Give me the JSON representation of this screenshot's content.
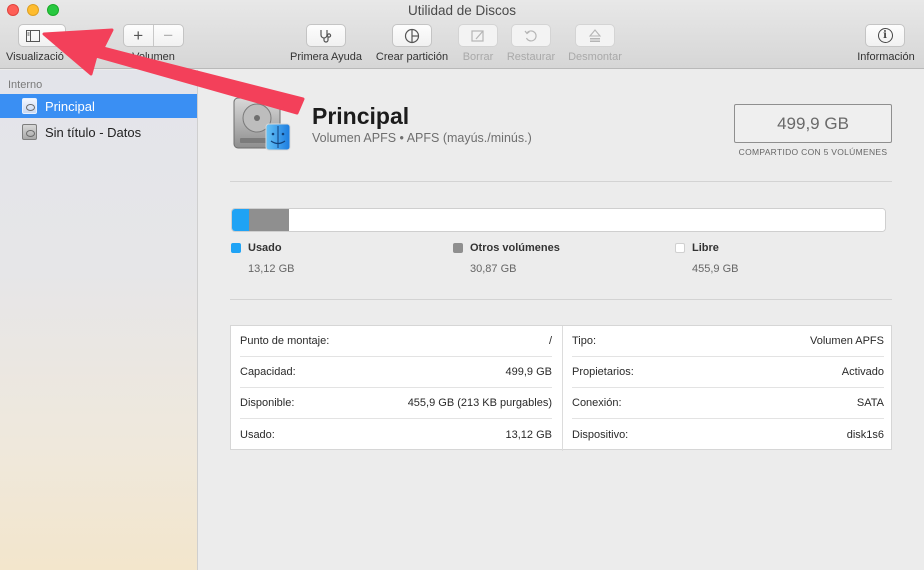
{
  "window": {
    "title": "Utilidad de Discos"
  },
  "toolbar": {
    "view_label": "Visualizació",
    "volume_label": "Volumen",
    "first_aid_label": "Primera Ayuda",
    "partition_label": "Crear partición",
    "erase_label": "Borrar",
    "restore_label": "Restaurar",
    "unmount_label": "Desmontar",
    "info_label": "Información",
    "volume_add_glyph": "+",
    "volume_remove_glyph": "−",
    "view_chevron_glyph": "⌄",
    "info_glyph": "i",
    "icons": [
      "sidebar-icon",
      "chevron-down-icon",
      "plus-icon",
      "minus-icon",
      "stethoscope-icon",
      "pie-chart-icon",
      "eraser-icon",
      "restore-icon",
      "eject-icon",
      "info-icon"
    ]
  },
  "sidebar": {
    "section": "Interno",
    "items": [
      {
        "label": "Principal",
        "selected": true
      },
      {
        "label": "Sin título - Datos",
        "selected": false
      }
    ]
  },
  "volume": {
    "name": "Principal",
    "subtitle": "Volumen APFS • APFS (mayús./minús.)",
    "capacity": "499,9 GB",
    "shared_note": "COMPARTIDO CON 5 VOLÚMENES"
  },
  "usage": {
    "total_gb": 499.9,
    "segments": [
      {
        "name": "Usado",
        "value": "13,12 GB",
        "gb": 13.12,
        "color": "#1fa3f5"
      },
      {
        "name": "Otros volúmenes",
        "value": "30,87 GB",
        "gb": 30.87,
        "color": "#8f8f8f"
      },
      {
        "name": "Libre",
        "value": "455,9 GB",
        "gb": 455.9,
        "color": "#ffffff"
      }
    ]
  },
  "details": {
    "left": [
      {
        "label": "Punto de montaje:",
        "value": "/"
      },
      {
        "label": "Capacidad:",
        "value": "499,9 GB"
      },
      {
        "label": "Disponible:",
        "value": "455,9 GB (213 KB purgables)"
      },
      {
        "label": "Usado:",
        "value": "13,12 GB"
      }
    ],
    "right": [
      {
        "label": "Tipo:",
        "value": "Volumen APFS"
      },
      {
        "label": "Propietarios:",
        "value": "Activado"
      },
      {
        "label": "Conexión:",
        "value": "SATA"
      },
      {
        "label": "Dispositivo:",
        "value": "disk1s6"
      }
    ]
  },
  "colors": {
    "accent": "#3a8ff3",
    "annotation_arrow": "#f3405a"
  }
}
